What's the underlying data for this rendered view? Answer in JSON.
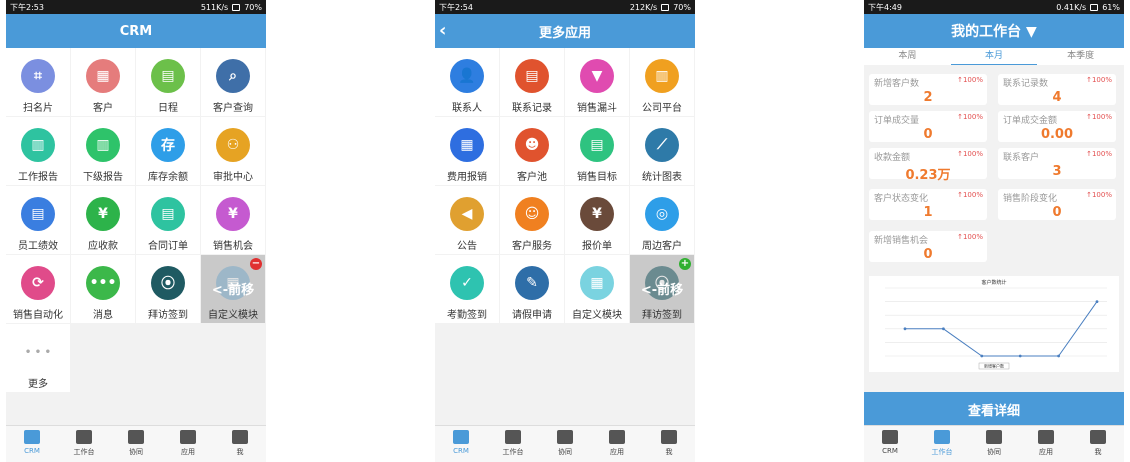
{
  "accent": "#4a9ad8",
  "phone1": {
    "status": {
      "time": "下午2:53",
      "net": "511K/s",
      "battery": "70%"
    },
    "title": "CRM",
    "items": [
      {
        "label": "扫名片",
        "icon": "scan-card-icon",
        "color": "#7b8fe0",
        "glyph": "⌗"
      },
      {
        "label": "客户",
        "icon": "building-icon",
        "color": "#e57c7c",
        "glyph": "▦"
      },
      {
        "label": "日程",
        "icon": "calendar-icon",
        "color": "#6cc04a",
        "glyph": "▤"
      },
      {
        "label": "客户查询",
        "icon": "search-icon",
        "color": "#3f6fa8",
        "glyph": "⌕"
      },
      {
        "label": "工作报告",
        "icon": "report-icon",
        "color": "#2ec3a0",
        "glyph": "▥"
      },
      {
        "label": "下级报告",
        "icon": "sub-report-icon",
        "color": "#2ec36a",
        "glyph": "▥"
      },
      {
        "label": "库存余额",
        "icon": "stock-icon",
        "color": "#2e9ee8",
        "glyph": "存"
      },
      {
        "label": "审批中心",
        "icon": "approval-icon",
        "color": "#e6a323",
        "glyph": "⚇"
      },
      {
        "label": "员工绩效",
        "icon": "performance-icon",
        "color": "#3a7ee0",
        "glyph": "▤"
      },
      {
        "label": "应收款",
        "icon": "yuan-icon",
        "color": "#2db34a",
        "glyph": "¥"
      },
      {
        "label": "合同订单",
        "icon": "contract-icon",
        "color": "#2ec3a0",
        "glyph": "▤"
      },
      {
        "label": "销售机会",
        "icon": "opportunity-icon",
        "color": "#c55ad0",
        "glyph": "¥"
      },
      {
        "label": "销售自动化",
        "icon": "automation-icon",
        "color": "#e04b8a",
        "glyph": "⟳"
      },
      {
        "label": "消息",
        "icon": "message-icon",
        "color": "#3cb84a",
        "glyph": "•••"
      },
      {
        "label": "拜访签到",
        "icon": "location-icon",
        "color": "#1f5a62",
        "glyph": "⦿"
      },
      {
        "label": "自定义模块",
        "icon": "custom-module-icon",
        "color": "#7aa9c8",
        "glyph": "▦",
        "selected": true,
        "overlay": "<-前移",
        "badge": "−",
        "badge_color": "#e03030"
      },
      {
        "label": "更多",
        "icon": "more-icon",
        "color": "#ffffff",
        "glyph": "• • •",
        "more": true
      }
    ]
  },
  "phone2": {
    "status": {
      "time": "下午2:54",
      "net": "212K/s",
      "battery": "70%"
    },
    "title": "更多应用",
    "items": [
      {
        "label": "联系人",
        "icon": "contact-icon",
        "color": "#2e7ee0",
        "glyph": "👤"
      },
      {
        "label": "联系记录",
        "icon": "contact-record-icon",
        "color": "#e0532e",
        "glyph": "▤"
      },
      {
        "label": "销售漏斗",
        "icon": "funnel-icon",
        "color": "#e04bb0",
        "glyph": "▼"
      },
      {
        "label": "公司平台",
        "icon": "book-icon",
        "color": "#f0a020",
        "glyph": "▥"
      },
      {
        "label": "费用报销",
        "icon": "calculator-icon",
        "color": "#2e6ee0",
        "glyph": "▦"
      },
      {
        "label": "客户池",
        "icon": "customer-pool-icon",
        "color": "#e0532e",
        "glyph": "☻"
      },
      {
        "label": "销售目标",
        "icon": "target-icon",
        "color": "#2ec380",
        "glyph": "▤"
      },
      {
        "label": "统计图表",
        "icon": "chart-icon",
        "color": "#2e7aa8",
        "glyph": "⟋"
      },
      {
        "label": "公告",
        "icon": "megaphone-icon",
        "color": "#e0a030",
        "glyph": "◀"
      },
      {
        "label": "客户服务",
        "icon": "service-icon",
        "color": "#f08020",
        "glyph": "☺"
      },
      {
        "label": "报价单",
        "icon": "quote-icon",
        "color": "#6a4a3a",
        "glyph": "¥"
      },
      {
        "label": "周边客户",
        "icon": "nearby-icon",
        "color": "#2e9ee8",
        "glyph": "◎"
      },
      {
        "label": "考勤签到",
        "icon": "attendance-icon",
        "color": "#2ec3b0",
        "glyph": "✓"
      },
      {
        "label": "请假申请",
        "icon": "leave-icon",
        "color": "#2e6ea8",
        "glyph": "✎"
      },
      {
        "label": "自定义模块",
        "icon": "custom-module-icon",
        "color": "#7ad3e0",
        "glyph": "▦"
      },
      {
        "label": "拜访签到",
        "icon": "location-icon",
        "color": "#1f5a62",
        "glyph": "⦿",
        "selected": true,
        "overlay": "<-前移",
        "badge": "+",
        "badge_color": "#30b030"
      }
    ]
  },
  "phone3": {
    "status": {
      "time": "下午4:49",
      "net": "0.41K/s",
      "battery": "61%"
    },
    "title": "我的工作台 ▼",
    "tabs": [
      "本周",
      "本月",
      "本季度"
    ],
    "active_tab": 1,
    "stats": [
      {
        "label": "新增客户数",
        "value": "2",
        "pct": "↑100%"
      },
      {
        "label": "联系记录数",
        "value": "4",
        "pct": "↑100%"
      },
      {
        "label": "订单成交量",
        "value": "0",
        "pct": "↑100%"
      },
      {
        "label": "订单成交金额",
        "value": "0.00",
        "pct": "↑100%"
      },
      {
        "label": "收款金额",
        "value": "0.23万",
        "pct": "↑100%"
      },
      {
        "label": "联系客户",
        "value": "3",
        "pct": "↑100%"
      },
      {
        "label": "客户状态变化",
        "value": "1",
        "pct": "↑100%"
      },
      {
        "label": "销售阶段变化",
        "value": "0",
        "pct": "↑100%"
      },
      {
        "label": "新增销售机会",
        "value": "0",
        "pct": "↑100%"
      }
    ],
    "detail_button": "查看详细"
  },
  "tabbar": [
    {
      "label": "CRM",
      "icon": "pie-chart-icon"
    },
    {
      "label": "工作台",
      "icon": "monitor-icon"
    },
    {
      "label": "协同",
      "icon": "edit-icon"
    },
    {
      "label": "应用",
      "icon": "box-icon"
    },
    {
      "label": "我",
      "icon": "user-icon"
    }
  ],
  "chart_data": {
    "type": "line",
    "title": "客户数统计",
    "categories": [
      "",
      "",
      "",
      "",
      "",
      ""
    ],
    "series": [
      {
        "name": "新增客户数",
        "values": [
          2,
          2,
          0,
          0,
          0,
          4
        ]
      }
    ],
    "ylim": [
      0,
      5
    ],
    "grid": true,
    "legend": "bottom"
  }
}
